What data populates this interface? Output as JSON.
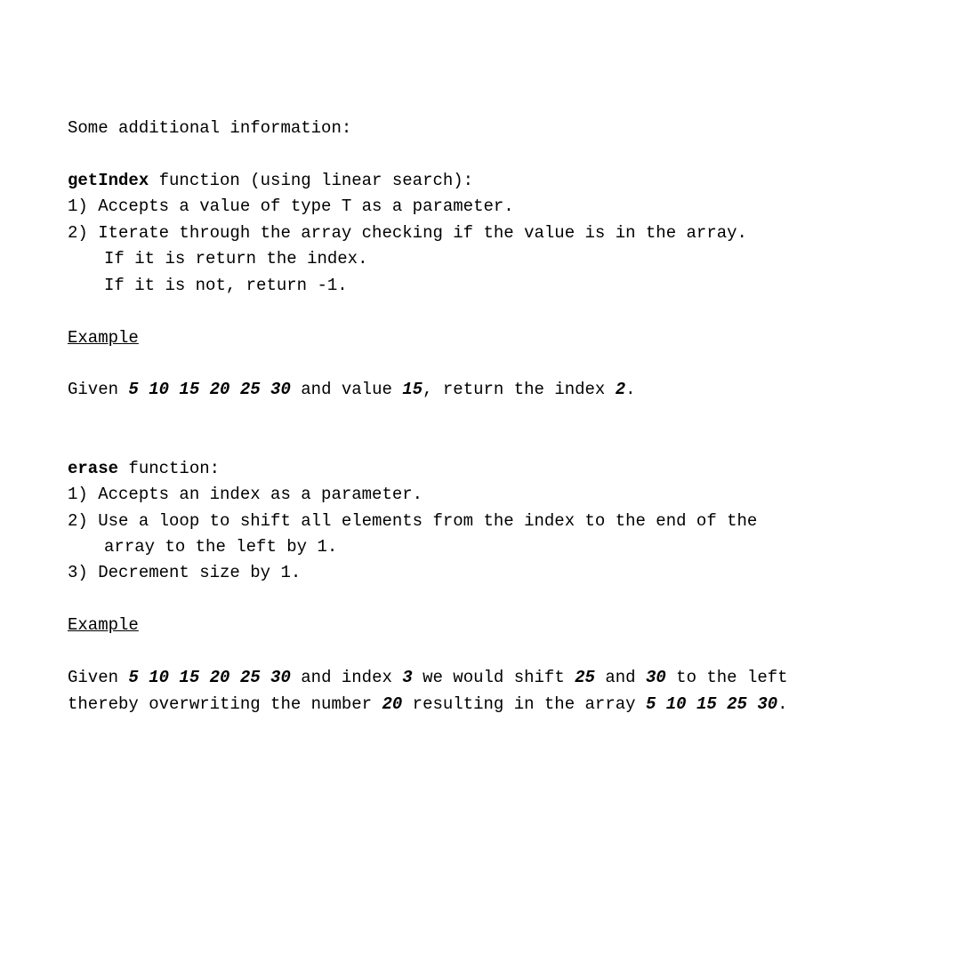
{
  "intro": "Some additional information:",
  "getIndex": {
    "name": "getIndex",
    "heading_rest": " function (using linear search):",
    "steps": {
      "s1": "1) Accepts a value of type T as a parameter.",
      "s2": "2) Iterate through the array checking if the value is in the array.",
      "s2a": "If it is return the index.",
      "s2b": "If it is not, return -1."
    },
    "example_label": "Example",
    "example": {
      "t1": "Given ",
      "arr": "5 10 15 20 25 30",
      "t2": " and value ",
      "val": "15",
      "t3": ", return the index ",
      "result": "2",
      "t4": "."
    }
  },
  "erase": {
    "name": "erase",
    "heading_rest": " function:",
    "steps": {
      "s1": "1) Accepts an index as a parameter.",
      "s2": "2) Use a loop to shift all elements from the index to the end of the",
      "s2a": "array to the left by 1.",
      "s3": "3) Decrement size by 1."
    },
    "example_label": "Example",
    "example": {
      "t1": "Given ",
      "arr": "5 10 15 20 25 30",
      "t2": " and index ",
      "idx": "3",
      "t3": " we would shift ",
      "shift1": "25",
      "t4": " and ",
      "shift2": "30",
      "t5": " to the left",
      "t6": "thereby overwriting the number ",
      "overwrite": "20",
      "t7": " resulting in the array ",
      "result_arr": "5 10 15 25 30",
      "t8": "."
    }
  }
}
